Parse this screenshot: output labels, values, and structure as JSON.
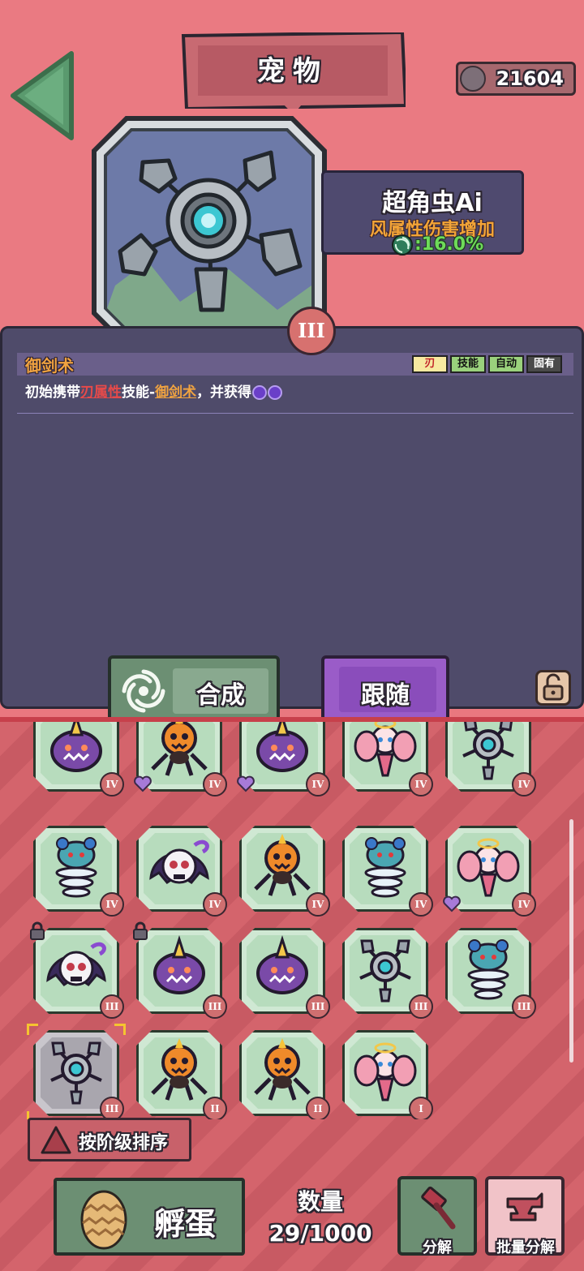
{
  "header": {
    "title": "宠物",
    "currency_value": "21604",
    "currency_icon": "gear-coin-icon",
    "back_icon": "back-arrow-icon"
  },
  "pet": {
    "name": "超角虫Ai",
    "attribute": "风属性伤害增加",
    "value": ":16.0%",
    "element_icon": "wind-icon",
    "tier": "III"
  },
  "skill": {
    "name": "御剑术",
    "tags": [
      "刃",
      "技能",
      "自动",
      "固有"
    ],
    "desc_part1": "初始携带",
    "desc_part2": "刃属性",
    "desc_part3": "技能-",
    "desc_part4": "御剑术",
    "desc_part5": "，并获得"
  },
  "actions": {
    "synth_label": "合成",
    "follow_label": "跟随"
  },
  "grid": {
    "cells": [
      {
        "pet": "purple-horn",
        "tier": "IV",
        "heart": false,
        "lock": false
      },
      {
        "pet": "pumpkin-spider",
        "tier": "IV",
        "heart": true,
        "lock": false
      },
      {
        "pet": "purple-horn",
        "tier": "IV",
        "heart": true,
        "lock": false
      },
      {
        "pet": "pink-fairy",
        "tier": "IV",
        "heart": false,
        "lock": false
      },
      {
        "pet": "robot-claw",
        "tier": "IV",
        "heart": false,
        "lock": false
      },
      {
        "pet": "blue-spring",
        "tier": "IV",
        "heart": false,
        "lock": false
      },
      {
        "pet": "skull-ghost",
        "tier": "IV",
        "heart": false,
        "lock": false
      },
      {
        "pet": "pumpkin-spider",
        "tier": "IV",
        "heart": false,
        "lock": false
      },
      {
        "pet": "blue-spring",
        "tier": "IV",
        "heart": false,
        "lock": false
      },
      {
        "pet": "pink-fairy",
        "tier": "IV",
        "heart": true,
        "lock": false
      },
      {
        "pet": "skull-ghost",
        "tier": "III",
        "heart": false,
        "lock": true
      },
      {
        "pet": "purple-horn",
        "tier": "III",
        "heart": false,
        "lock": true
      },
      {
        "pet": "purple-horn",
        "tier": "III",
        "heart": false,
        "lock": false
      },
      {
        "pet": "robot-claw",
        "tier": "III",
        "heart": false,
        "lock": false
      },
      {
        "pet": "blue-spring",
        "tier": "III",
        "heart": false,
        "lock": false
      },
      {
        "pet": "robot-claw",
        "tier": "III",
        "heart": false,
        "lock": false,
        "selected": true
      },
      {
        "pet": "pumpkin-spider",
        "tier": "II",
        "heart": false,
        "lock": false
      },
      {
        "pet": "pumpkin-spider",
        "tier": "II",
        "heart": false,
        "lock": false
      },
      {
        "pet": "pink-fairy",
        "tier": "I",
        "heart": false,
        "lock": false
      }
    ]
  },
  "bottom": {
    "sort_label": "按阶级排序",
    "hatch_label": "孵蛋",
    "count_title": "数量",
    "count_value": "29/1000",
    "decompose_label": "分解",
    "batch_label": "批量分解"
  },
  "colors": {
    "background": "#e9787f",
    "panel": "#4f4b6a",
    "green_button": "#6c8f73",
    "purple_button": "#9a5cc8"
  }
}
